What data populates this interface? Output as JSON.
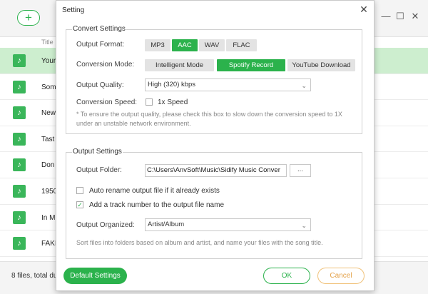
{
  "app": {
    "add_label": "+",
    "window_controls": [
      "—",
      "☐",
      "✕"
    ],
    "column_title": "Title",
    "tracks": [
      {
        "name": "Your",
        "selected": true
      },
      {
        "name": "Som",
        "selected": false
      },
      {
        "name": "New",
        "selected": false
      },
      {
        "name": "Tast",
        "selected": false
      },
      {
        "name": "Don",
        "selected": false
      },
      {
        "name": "1950",
        "selected": false
      },
      {
        "name": "In M",
        "selected": false
      },
      {
        "name": "FAKI",
        "selected": false
      }
    ],
    "file_count": "8 files, total du",
    "note_icon": "music-note-icon"
  },
  "dialog": {
    "title": "Setting",
    "close_label": "✕",
    "convert": {
      "legend": "Convert Settings",
      "output_format_label": "Output Format:",
      "formats": [
        "MP3",
        "AAC",
        "WAV",
        "FLAC"
      ],
      "selected_format": "AAC",
      "conversion_mode_label": "Conversion Mode:",
      "modes": [
        "Intelligent Mode",
        "Spotify Record",
        "YouTube Download"
      ],
      "selected_mode": "Spotify Record",
      "output_quality_label": "Output Quality:",
      "output_quality_value": "High (320) kbps",
      "conversion_speed_label": "Conversion Speed:",
      "speed_checkbox_label": "1x Speed",
      "speed_checked": false,
      "note": "* To ensure the output quality, please check this box to slow down the conversion speed to 1X under an unstable network environment."
    },
    "output": {
      "legend": "Output Settings",
      "output_folder_label": "Output Folder:",
      "output_folder_value": "C:\\Users\\AnvSoft\\Music\\Sidify Music Conver",
      "browse_label": "...",
      "auto_rename_label": "Auto rename output file if it already exists",
      "auto_rename_checked": false,
      "track_number_label": "Add a track number to the output file name",
      "track_number_checked": true,
      "output_organized_label": "Output Organized:",
      "output_organized_value": "Artist/Album",
      "organize_note": "Sort files into folders based on album and artist, and name your files with the song title."
    },
    "default_label": "Default Settings",
    "ok_label": "OK",
    "cancel_label": "Cancel"
  },
  "colors": {
    "accent": "#2bb24c",
    "selected_row": "#cdeecf",
    "cancel_border": "#f0c27a"
  }
}
